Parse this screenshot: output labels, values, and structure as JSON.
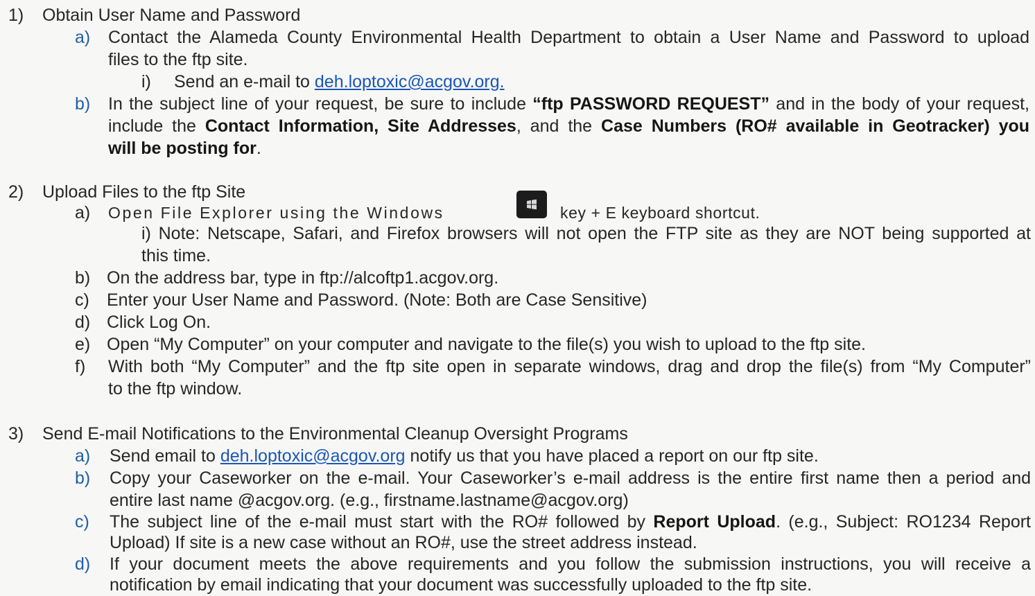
{
  "sections": [
    {
      "num": "1)",
      "title": "Obtain User Name and Password",
      "a": {
        "marker": "a)",
        "line1": "Contact the Alameda County Environmental Health Department to obtain a User Name and Password to upload",
        "line2": "files to the ftp site.",
        "sub": {
          "marker": "i)",
          "text": "Send an e-mail to ",
          "link": "deh.loptoxic@acgov.org."
        }
      },
      "b": {
        "marker": "b)",
        "l1_pre": "In the subject line of your request, be sure to include ",
        "l1_bold": "“ftp PASSWORD REQUEST”",
        "l1_post": " and in the body of your request,",
        "l2_pre": "include the ",
        "l2_bold1": "Contact Information, Site Addresses",
        "l2_mid": ", and the ",
        "l2_bold2": "Case Numbers (RO# available in Geotracker) you",
        "l3_bold": "will be posting for",
        "l3_post": "."
      }
    },
    {
      "num": "2)",
      "title": "Upload Files to the ftp Site",
      "a": {
        "marker": "a)",
        "pre": "Open File Explorer using the Windows",
        "post": "key  + E keyboard shortcut.",
        "note1": "i) Note: Netscape, Safari, and Firefox browsers will not open the FTP site as they are NOT being supported at",
        "note2": "this time."
      },
      "b": {
        "marker": "b)",
        "text": "On the address bar, type in  ftp://alcoftp1.acgov.org."
      },
      "c": {
        "marker": "c)",
        "text": "Enter your User Name and Password. (Note: Both are Case Sensitive)"
      },
      "d": {
        "marker": "d)",
        "text": "Click Log On."
      },
      "e": {
        "marker": "e)",
        "text": "Open “My Computer” on your computer and navigate to the file(s) you wish to upload to the ftp site."
      },
      "f": {
        "marker": "f)",
        "line1": "With both “My Computer” and the ftp site open in separate windows, drag and drop the file(s) from “My Computer”",
        "line2": "to the ftp window."
      }
    },
    {
      "num": "3)",
      "title": "Send E-mail Notifications to the Environmental Cleanup Oversight Programs",
      "a": {
        "marker": "a)",
        "pre": "Send email to ",
        "link": "deh.loptoxic@acgov.org",
        "post": " notify us that you have placed a report on our ftp site."
      },
      "b": {
        "marker": "b)",
        "line1": "Copy your Caseworker on the e-mail.  Your Caseworker’s e-mail address is the entire first name then a period and",
        "line2": "entire last name @acgov.org.  (e.g., firstname.lastname@acgov.org)"
      },
      "c": {
        "marker": "c)",
        "l1_pre": "The subject line of the e-mail must start with the RO# followed by ",
        "l1_bold": "Report Upload",
        "l1_post": ".  (e.g., Subject: RO1234 Report",
        "line2": "Upload)  If site is a new case without an RO#, use the street address instead."
      },
      "d": {
        "marker": "d)",
        "line1": "If your document meets the above requirements and you follow the submission instructions, you will receive a",
        "line2": "notification by email indicating that your document was successfully uploaded to the ftp site."
      }
    }
  ],
  "icons": {
    "windows_key": "windows-logo-icon"
  },
  "colors": {
    "marker_blue": "#1f5fa8",
    "link_blue": "#1a56b8",
    "text": "#262626",
    "background": "#f7f7f6"
  }
}
